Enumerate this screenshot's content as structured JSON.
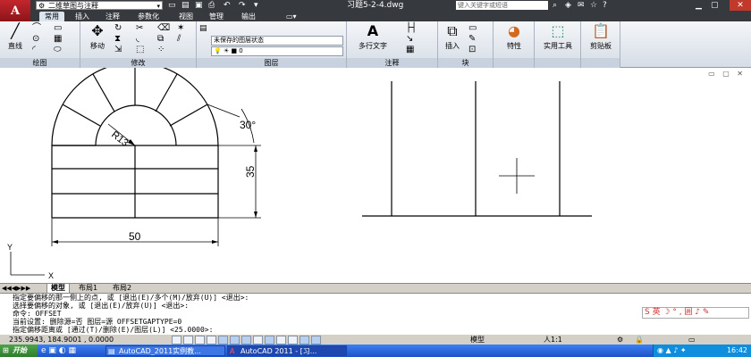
{
  "titlebar": {
    "logo": "A",
    "workspace": "二维草图与注释",
    "doc_title": "习题5-2-4.dwg",
    "search_placeholder": "键入关键字或短语",
    "quick_access": [
      "new-icon",
      "open-icon",
      "save-icon",
      "undo-icon",
      "redo-icon",
      "print-icon"
    ]
  },
  "ribbon_tabs": [
    "常用",
    "插入",
    "注释",
    "参数化",
    "视图",
    "管理",
    "输出"
  ],
  "ribbon": {
    "draw": {
      "title": "绘图",
      "line_label": "直线"
    },
    "modify": {
      "title": "修改",
      "move_label": "移动"
    },
    "layers": {
      "title": "图层",
      "state_value": "未保存的图层状态",
      "layer_value": "0"
    },
    "annotation": {
      "title": "注释",
      "mtext_label": "多行文字"
    },
    "block": {
      "title": "块",
      "insert_label": "插入"
    },
    "properties": {
      "label": "特性"
    },
    "utilities": {
      "label": "实用工具"
    },
    "clipboard": {
      "label": "剪贴板"
    }
  },
  "drawing": {
    "angle_label": "30°",
    "radius_label": "R13",
    "height_label": "35",
    "width_label": "50",
    "ucs_x": "X",
    "ucs_y": "Y"
  },
  "layout_tabs": [
    "模型",
    "布局1",
    "布局2"
  ],
  "command": {
    "lines": [
      "指定要偏移的那一侧上的点, 或 [退出(E)/多个(M)/放弃(U)] <退出>:",
      "选择要偏移的对象, 或 [退出(E)/放弃(U)] <退出>:",
      "命令: OFFSET",
      "当前设置: 删除源=否  图层=源  OFFSETGAPTYPE=0",
      "指定偏移距离或 [通过(T)/删除(E)/图层(L)] <25.0000>:"
    ]
  },
  "ime": {
    "text": "S 英 ☽ ° , 囲 ♪ ✎"
  },
  "status": {
    "coords": "235.9943, 184.9001 , 0.0000",
    "model_label": "模型",
    "scale_label": "人1:1"
  },
  "taskbar": {
    "start_label": "开始",
    "tasks": [
      "AutoCAD_2011实例教...",
      "AutoCAD 2011 - [习..."
    ],
    "clock": "16:42"
  },
  "colors": {
    "accent": "#c2272d",
    "title_bar": "#36393e",
    "taskbar": "#245edb"
  }
}
